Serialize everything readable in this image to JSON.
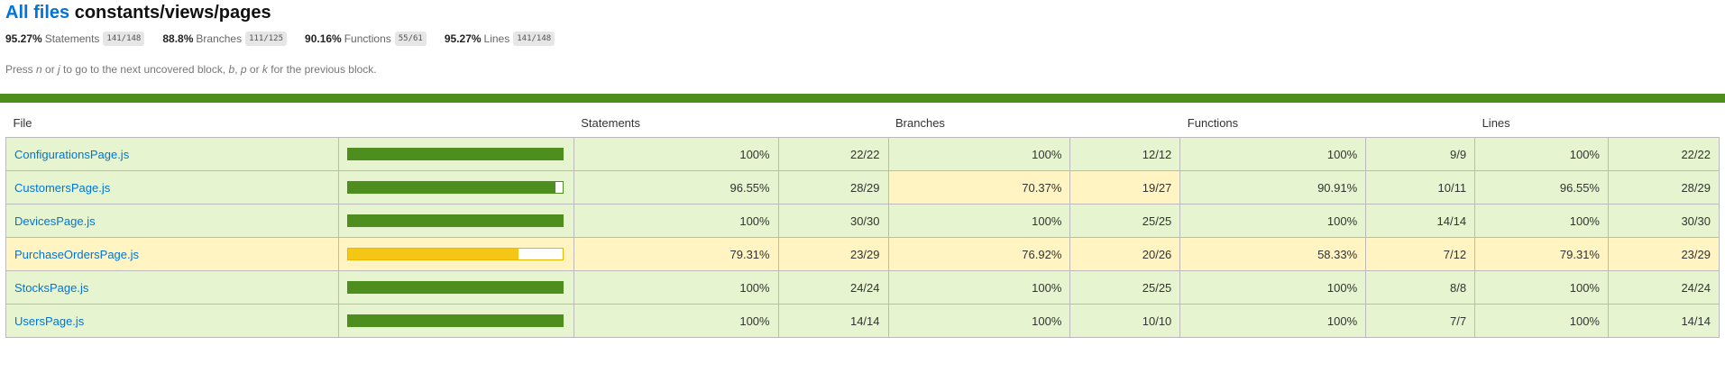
{
  "header": {
    "all_files_link": "All files",
    "path": "constants/views/pages"
  },
  "summary": [
    {
      "pct": "95.27%",
      "label": "Statements",
      "fraction": "141/148"
    },
    {
      "pct": "88.8%",
      "label": "Branches",
      "fraction": "111/125"
    },
    {
      "pct": "90.16%",
      "label": "Functions",
      "fraction": "55/61"
    },
    {
      "pct": "95.27%",
      "label": "Lines",
      "fraction": "141/148"
    }
  ],
  "hint": {
    "pre": "Press ",
    "k1": "n",
    "mid1": " or ",
    "k2": "j",
    "mid2": " to go to the next uncovered block, ",
    "k3": "b",
    "mid3": ", ",
    "k4": "p",
    "mid4": " or ",
    "k5": "k",
    "post": " for the previous block."
  },
  "colors": {
    "high": "#4d8e1e",
    "medium": "#f6c614",
    "high_bg": "#e6f5d0",
    "medium_bg": "#fff4c2"
  },
  "table": {
    "headers": {
      "file": "File",
      "statements": "Statements",
      "branches": "Branches",
      "functions": "Functions",
      "lines": "Lines"
    },
    "rows": [
      {
        "file": "ConfigurationsPage.js",
        "coverage": 1.0,
        "level": "high",
        "stmt_pct": "100%",
        "stmt_frac": "22/22",
        "br_pct": "100%",
        "br_frac": "12/12",
        "fn_pct": "100%",
        "fn_frac": "9/9",
        "ln_pct": "100%",
        "ln_frac": "22/22"
      },
      {
        "file": "CustomersPage.js",
        "coverage": 0.9655,
        "level": "high",
        "branches_level": "medium",
        "stmt_pct": "96.55%",
        "stmt_frac": "28/29",
        "br_pct": "70.37%",
        "br_frac": "19/27",
        "fn_pct": "90.91%",
        "fn_frac": "10/11",
        "ln_pct": "96.55%",
        "ln_frac": "28/29"
      },
      {
        "file": "DevicesPage.js",
        "coverage": 1.0,
        "level": "high",
        "stmt_pct": "100%",
        "stmt_frac": "30/30",
        "br_pct": "100%",
        "br_frac": "25/25",
        "fn_pct": "100%",
        "fn_frac": "14/14",
        "ln_pct": "100%",
        "ln_frac": "30/30"
      },
      {
        "file": "PurchaseOrdersPage.js",
        "coverage": 0.7931,
        "level": "medium",
        "stmt_pct": "79.31%",
        "stmt_frac": "23/29",
        "br_pct": "76.92%",
        "br_frac": "20/26",
        "fn_pct": "58.33%",
        "fn_frac": "7/12",
        "ln_pct": "79.31%",
        "ln_frac": "23/29"
      },
      {
        "file": "StocksPage.js",
        "coverage": 1.0,
        "level": "high",
        "stmt_pct": "100%",
        "stmt_frac": "24/24",
        "br_pct": "100%",
        "br_frac": "25/25",
        "fn_pct": "100%",
        "fn_frac": "8/8",
        "ln_pct": "100%",
        "ln_frac": "24/24"
      },
      {
        "file": "UsersPage.js",
        "coverage": 1.0,
        "level": "high",
        "stmt_pct": "100%",
        "stmt_frac": "14/14",
        "br_pct": "100%",
        "br_frac": "10/10",
        "fn_pct": "100%",
        "fn_frac": "7/7",
        "ln_pct": "100%",
        "ln_frac": "14/14"
      }
    ]
  }
}
